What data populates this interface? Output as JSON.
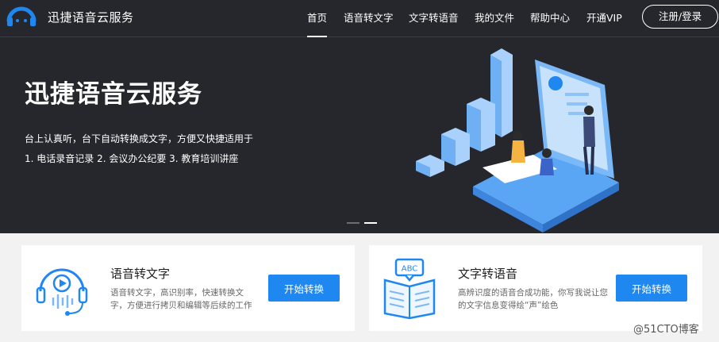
{
  "header": {
    "brand": "迅捷语音云服务",
    "nav": [
      "首页",
      "语音转文字",
      "文字转语音",
      "我的文件",
      "帮助中心",
      "开通VIP"
    ],
    "login": "注册/登录"
  },
  "hero": {
    "title": "迅捷语音云服务",
    "desc_line1": "台上认真听，台下自动转换成文字，方便又快捷适用于",
    "desc_line2": "1. 电话录音记录  2. 会议办公纪要  3. 教育培训讲座"
  },
  "cards": [
    {
      "title": "语音转文字",
      "desc": "语音转文字，高识别率，快速转换文字，方便进行拷贝和编辑等后续的工作",
      "button": "开始转换",
      "icon": "headphones-icon"
    },
    {
      "title": "文字转语音",
      "desc": "高辨识度的语音合成功能，你写我说让您的文字信息变得绘“声”绘色",
      "button": "开始转换",
      "icon": "abc-book-icon",
      "icon_text": "ABC"
    }
  ],
  "watermark": "@51CTO博客",
  "colors": {
    "accent": "#1f87f0",
    "hero_bg": "#25272d"
  }
}
